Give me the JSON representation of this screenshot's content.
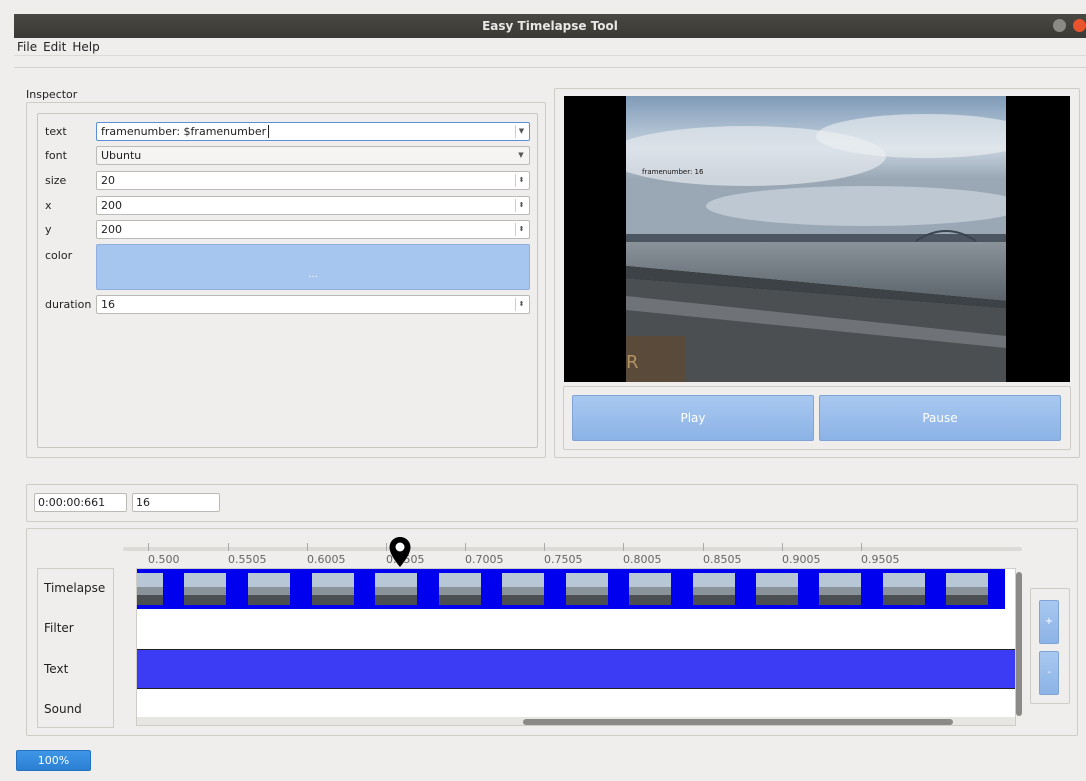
{
  "window": {
    "title": "Easy Timelapse Tool"
  },
  "menu": {
    "items": [
      "File",
      "Edit",
      "Help"
    ]
  },
  "inspector": {
    "title": "Inspector",
    "fields": {
      "text": {
        "label": "text",
        "value": "framenumber: $framenumber"
      },
      "font": {
        "label": "font",
        "value": "Ubuntu"
      },
      "size": {
        "label": "size",
        "value": "20"
      },
      "x": {
        "label": "x",
        "value": "200"
      },
      "y": {
        "label": "y",
        "value": "200"
      },
      "color": {
        "label": "color",
        "button": "..."
      },
      "duration": {
        "label": "duration",
        "value": "16"
      }
    }
  },
  "preview": {
    "overlay_text": "framenumber: 16"
  },
  "controls": {
    "play": "Play",
    "pause": "Pause"
  },
  "time": {
    "timecode": "0:00:00:661",
    "frame": "16"
  },
  "timeline": {
    "ticks": [
      "0.500",
      "0.5505",
      "0.6005",
      "0.6505",
      "0.7005",
      "0.7505",
      "0.8005",
      "0.8505",
      "0.9005",
      "0.9505"
    ],
    "tracks": [
      "Timelapse",
      "Filter",
      "Text",
      "Sound"
    ]
  },
  "zoom": {
    "plus": "+",
    "minus": "-",
    "level": "100%"
  },
  "colors": {
    "accent": "#8cb3e6",
    "track_blue": "#0000ee",
    "text_track": "#3c3cf5"
  },
  "icons": {
    "marker": "map-pin-icon"
  }
}
